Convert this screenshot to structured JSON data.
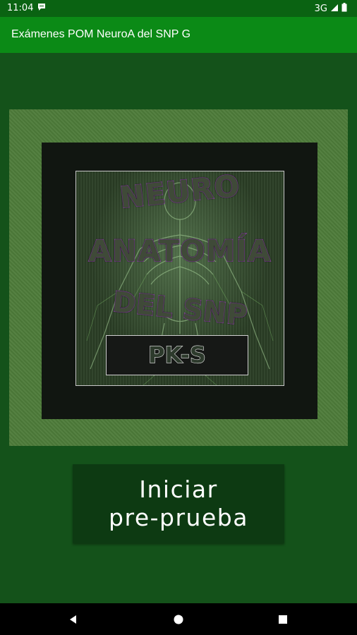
{
  "status_bar": {
    "time": "11:04",
    "network": "3G"
  },
  "app_bar": {
    "title": "Exámenes POM NeuroA del SNP G"
  },
  "cover": {
    "line1": "NEURO",
    "line2": "ANATOMÍA",
    "line3": "DEL SNP",
    "badge": "PK-S"
  },
  "actions": {
    "start_label": "Iniciar\npre-prueba"
  },
  "navigation": {
    "back_icon": "back-triangle-icon",
    "home_icon": "home-circle-icon",
    "recents_icon": "recents-square-icon"
  },
  "colors": {
    "status_bar": "#0a6312",
    "app_bar": "#0b8a16",
    "background": "#14521a",
    "button": "#0d3a12",
    "cover_outline": "#b34dd6"
  }
}
